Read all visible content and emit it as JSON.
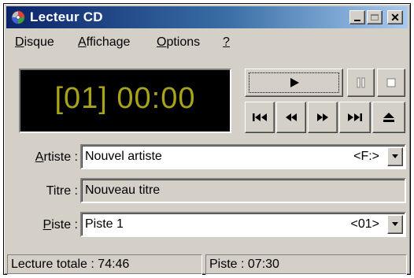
{
  "window": {
    "title": "Lecteur CD"
  },
  "menu": {
    "disque_first": "D",
    "disque_rest": "isque",
    "affichage_first": "A",
    "affichage_rest": "ffichage",
    "options_first": "O",
    "options_rest": "ptions",
    "help": "?"
  },
  "display": {
    "time": "[01] 00:00"
  },
  "controls": {
    "play": "play-icon",
    "pause": "pause-icon",
    "stop": "stop-icon",
    "previous_track": "previous-track-icon",
    "rewind": "rewind-icon",
    "fast_forward": "fast-forward-icon",
    "next_track": "next-track-icon",
    "eject": "eject-icon"
  },
  "fields": {
    "artist_label_first": "A",
    "artist_label_rest": "rtiste :",
    "artist_value": "Nouvel artiste",
    "artist_drive": "<F:>",
    "title_label": "Titre :",
    "title_value": "Nouveau titre",
    "track_label_first": "P",
    "track_label_rest": "iste :",
    "track_value": "Piste 1",
    "track_number": "<01>"
  },
  "status": {
    "total": "Lecture totale : 74:46",
    "track": "Piste : 07:30"
  },
  "colors": {
    "display_text": "#a7a31b",
    "titlebar_start": "#0a246a",
    "titlebar_end": "#a6caf0"
  }
}
